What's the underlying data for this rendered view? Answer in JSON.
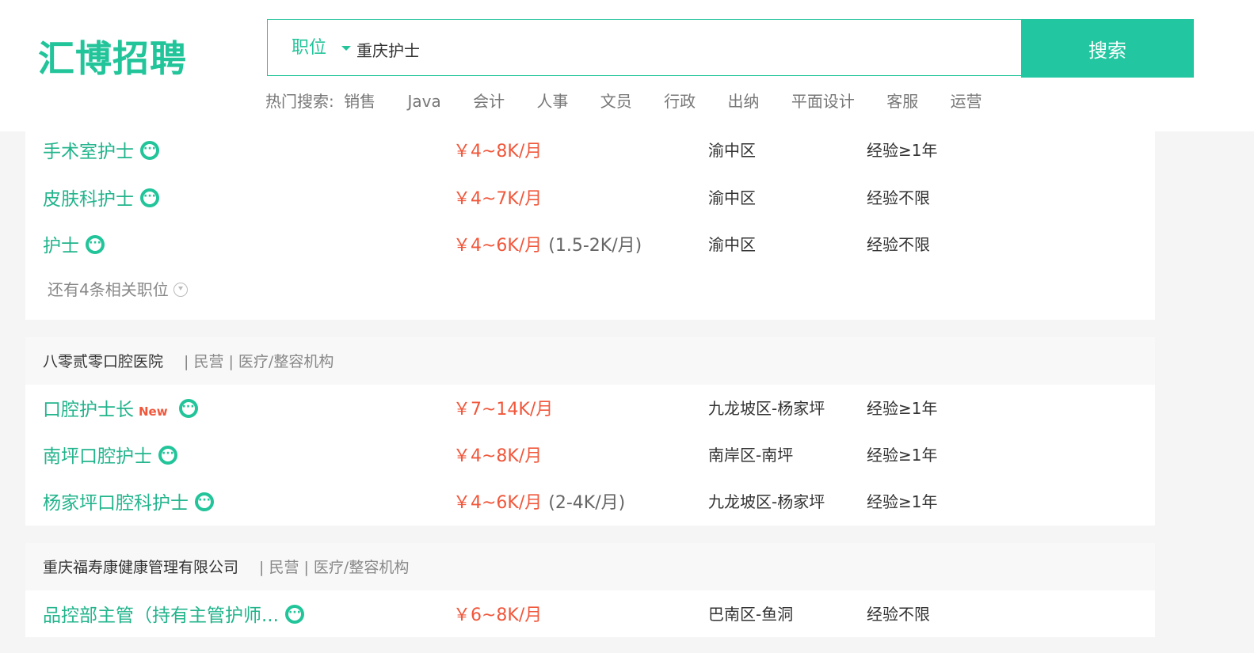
{
  "header": {
    "logo": "汇博招聘",
    "search_type": "职位",
    "search_value": "重庆护士",
    "search_button": "搜索",
    "hot_label": "热门搜索:",
    "hot_items": [
      "销售",
      "Java",
      "会计",
      "人事",
      "文员",
      "行政",
      "出纳",
      "平面设计",
      "客服",
      "运营"
    ]
  },
  "groups": [
    {
      "jobs": [
        {
          "title": "手术室护士",
          "salary": "￥4~8K/月",
          "salary_extra": "",
          "area": "渝中区",
          "exp": "经验≥1年"
        },
        {
          "title": "皮肤科护士",
          "salary": "￥4~7K/月",
          "salary_extra": "",
          "area": "渝中区",
          "exp": "经验不限"
        },
        {
          "title": "护士",
          "salary": "￥4~6K/月",
          "salary_extra": "(1.5-2K/月)",
          "area": "渝中区",
          "exp": "经验不限"
        }
      ],
      "more": "还有4条相关职位"
    },
    {
      "company": "八零贰零口腔医院",
      "meta": "| 民营 | 医疗/整容机构",
      "jobs": [
        {
          "title": "口腔护士长",
          "badge": "New",
          "salary": "￥7~14K/月",
          "salary_extra": "",
          "area": "九龙坡区-杨家坪",
          "exp": "经验≥1年"
        },
        {
          "title": "南坪口腔护士",
          "salary": "￥4~8K/月",
          "salary_extra": "",
          "area": "南岸区-南坪",
          "exp": "经验≥1年"
        },
        {
          "title": "杨家坪口腔科护士",
          "salary": "￥4~6K/月",
          "salary_extra": "(2-4K/月)",
          "area": "九龙坡区-杨家坪",
          "exp": "经验≥1年"
        }
      ]
    },
    {
      "company": "重庆福寿康健康管理有限公司",
      "meta": "| 民营 | 医疗/整容机构",
      "jobs": [
        {
          "title": "品控部主管（持有主管护师...",
          "salary": "￥6~8K/月",
          "salary_extra": "",
          "area": "巴南区-鱼洞",
          "exp": "经验不限"
        }
      ]
    }
  ],
  "colors": {
    "accent": "#22c49a",
    "salary": "#f0573b"
  }
}
